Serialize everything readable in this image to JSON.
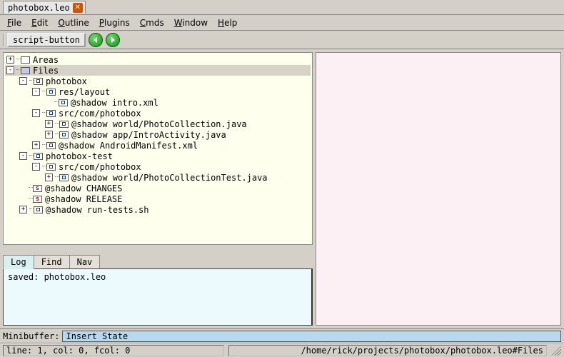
{
  "title": "photobox.leo",
  "menu": {
    "file": {
      "label": "File",
      "hotkey_index": 0
    },
    "edit": {
      "label": "Edit",
      "hotkey_index": 0
    },
    "outline": {
      "label": "Outline",
      "hotkey_index": 0
    },
    "plugins": {
      "label": "Plugins",
      "hotkey_index": 0
    },
    "cmds": {
      "label": "Cmds",
      "hotkey_index": 0
    },
    "window": {
      "label": "Window",
      "hotkey_index": 0
    },
    "help": {
      "label": "Help",
      "hotkey_index": 0
    }
  },
  "toolbar": {
    "script_button_label": "script-button"
  },
  "tree": [
    {
      "depth": 0,
      "toggle": "+",
      "box": "plain",
      "label": "Areas"
    },
    {
      "depth": 0,
      "toggle": "-",
      "box": "filled",
      "label": "Files",
      "selected": true
    },
    {
      "depth": 1,
      "toggle": "-",
      "box": "dot",
      "label": "photobox"
    },
    {
      "depth": 2,
      "toggle": "-",
      "box": "dot",
      "label": "res/layout"
    },
    {
      "depth": 3,
      "toggle": "",
      "box": "dot",
      "label": "@shadow intro.xml"
    },
    {
      "depth": 2,
      "toggle": "-",
      "box": "dot",
      "label": "src/com/photobox"
    },
    {
      "depth": 3,
      "toggle": "+",
      "box": "dot",
      "label": "@shadow world/PhotoCollection.java"
    },
    {
      "depth": 3,
      "toggle": "+",
      "box": "dot",
      "label": "@shadow app/IntroActivity.java"
    },
    {
      "depth": 2,
      "toggle": "+",
      "box": "dot",
      "label": "@shadow AndroidManifest.xml"
    },
    {
      "depth": 1,
      "toggle": "-",
      "box": "dot",
      "label": "photobox-test"
    },
    {
      "depth": 2,
      "toggle": "-",
      "box": "dot",
      "label": "src/com/photobox"
    },
    {
      "depth": 3,
      "toggle": "+",
      "box": "dot",
      "label": "@shadow world/PhotoCollectionTest.java"
    },
    {
      "depth": 1,
      "toggle": "",
      "box": "red-s",
      "label": "@shadow CHANGES"
    },
    {
      "depth": 1,
      "toggle": "",
      "box": "red-s",
      "label": "@shadow RELEASE"
    },
    {
      "depth": 1,
      "toggle": "+",
      "box": "dot",
      "label": "@shadow run-tests.sh"
    }
  ],
  "log_tabs": {
    "log": "Log",
    "find": "Find",
    "nav": "Nav"
  },
  "log_body": "saved: photobox.leo",
  "minibuffer": {
    "label": "Minibuffer:",
    "value": "Insert State"
  },
  "status": {
    "left": "line: 1, col: 0, fcol: 0",
    "right": "/home/rick/projects/photobox/photobox.leo#Files"
  }
}
